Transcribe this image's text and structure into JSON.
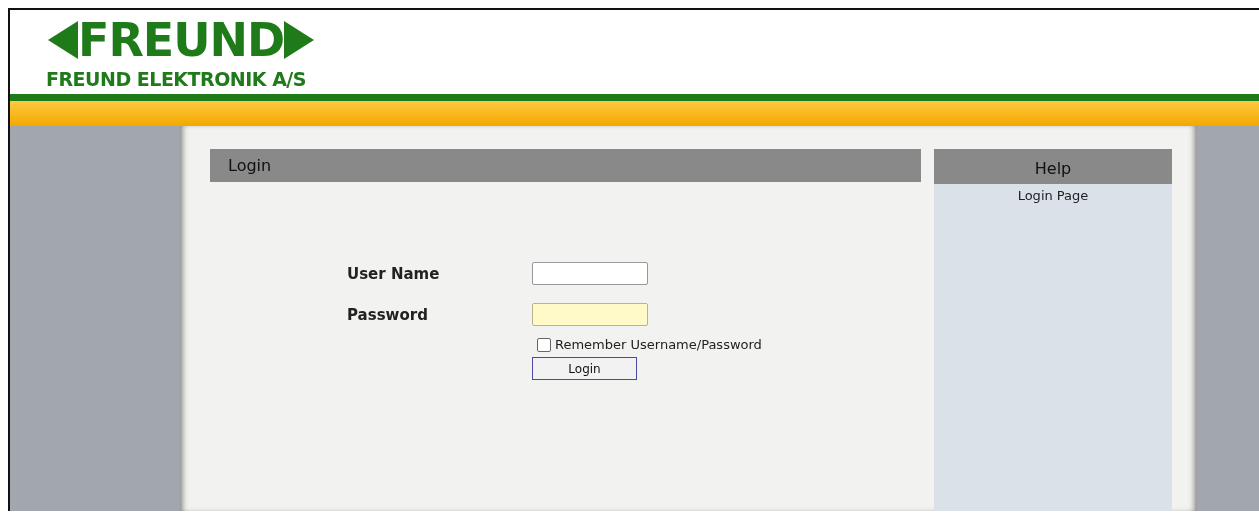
{
  "header": {
    "logo": "FREUND",
    "company": "FREUND ELEKTRONIK A/S"
  },
  "login_panel": {
    "title": "Login",
    "fields": [
      {
        "label": "User Name",
        "highlighted": false
      },
      {
        "label": "Password",
        "highlighted": true
      }
    ],
    "remember": {
      "label": "Remember Username/Password",
      "checked": false
    },
    "button": "Login"
  },
  "help_panel": {
    "title": "Help",
    "text": "Login Page"
  }
}
